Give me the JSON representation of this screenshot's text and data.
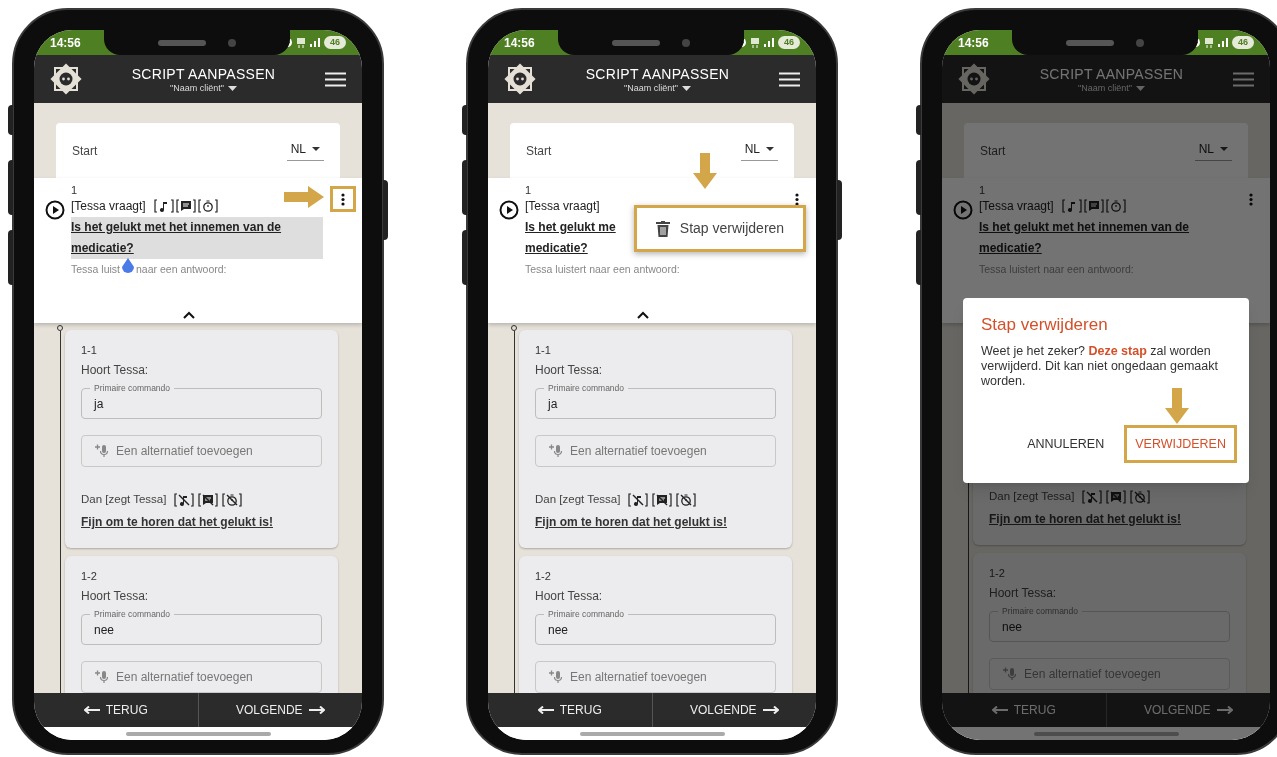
{
  "phones": [
    {
      "status": {
        "time": "14:56",
        "battery": "46"
      },
      "header": {
        "title": "SCRIPT AANPASSEN",
        "subtitle": "\"Naam cliënt\""
      },
      "start": {
        "label": "Start",
        "language": "NL"
      },
      "step": {
        "number": "1",
        "speaker": "[Tessa vraagt]",
        "show_tag_icons": true,
        "question_lines": [
          "Is het gelukt met het innemen van de",
          "medicatie?"
        ],
        "highlighted": true,
        "listen": [
          "Tessa luist",
          "naar een antwoord:"
        ],
        "more_button_highlighted": true
      },
      "substeps": [
        {
          "label": "1-1",
          "hears": "Hoort Tessa:",
          "field_label": "Primaire commando",
          "value": "ja",
          "placeholder": "Een alternatief toevoegen",
          "then": "Dan [zegt Tessa]",
          "reply": "Fijn om te horen dat het gelukt is!"
        },
        {
          "label": "1-2",
          "hears": "Hoort Tessa:",
          "field_label": "Primaire commando",
          "value": "nee",
          "placeholder": "Een alternatief toevoegen"
        }
      ],
      "nav": {
        "back": "TERUG",
        "next": "VOLGENDE"
      }
    },
    {
      "status": {
        "time": "14:56",
        "battery": "46"
      },
      "header": {
        "title": "SCRIPT AANPASSEN",
        "subtitle": "\"Naam cliënt\""
      },
      "start": {
        "label": "Start",
        "language": "NL"
      },
      "step": {
        "number": "1",
        "speaker": "[Tessa vraagt]",
        "show_tag_icons": false,
        "question_lines": [
          "Is het gelukt me",
          "medicatie?"
        ],
        "highlighted": false,
        "listen": [
          "Tessa luistert naar een antwoord:"
        ],
        "more_button_highlighted": false
      },
      "substeps": [
        {
          "label": "1-1",
          "hears": "Hoort Tessa:",
          "field_label": "Primaire commando",
          "value": "ja",
          "placeholder": "Een alternatief toevoegen",
          "then": "Dan [zegt Tessa]",
          "reply": "Fijn om te horen dat het gelukt is!"
        },
        {
          "label": "1-2",
          "hears": "Hoort Tessa:",
          "field_label": "Primaire commando",
          "value": "nee",
          "placeholder": "Een alternatief toevoegen"
        }
      ],
      "nav": {
        "back": "TERUG",
        "next": "VOLGENDE"
      },
      "menu": {
        "item": "Stap verwijderen",
        "highlighted": true
      }
    },
    {
      "status": {
        "time": "14:56",
        "battery": "46"
      },
      "header": {
        "title": "SCRIPT AANPASSEN",
        "subtitle": "\"Naam cliënt\""
      },
      "start": {
        "label": "Start",
        "language": "NL"
      },
      "step": {
        "number": "1",
        "speaker": "[Tessa vraagt]",
        "show_tag_icons": true,
        "question_lines": [
          "Is het gelukt met het innemen van de",
          "medicatie?"
        ],
        "highlighted": false,
        "listen": [
          "Tessa luistert naar een antwoord:"
        ],
        "more_button_highlighted": false
      },
      "substeps": [
        {
          "then": "Dan [zegt Tessa]",
          "reply": "Fijn om te horen dat het gelukt is!"
        },
        {
          "label": "1-2",
          "hears": "Hoort Tessa:",
          "field_label": "Primaire commando",
          "value": "nee",
          "placeholder": "Een alternatief toevoegen"
        }
      ],
      "nav": {
        "back": "TERUG",
        "next": "VOLGENDE"
      },
      "dialog": {
        "title": "Stap verwijderen",
        "message": "Weet je het zeker? **Deze stap** zal worden verwijderd. Dit kan niet ongedaan gemaakt worden.",
        "cancel": "ANNULEREN",
        "confirm": "VERWIJDEREN",
        "confirm_highlighted": true
      }
    }
  ]
}
